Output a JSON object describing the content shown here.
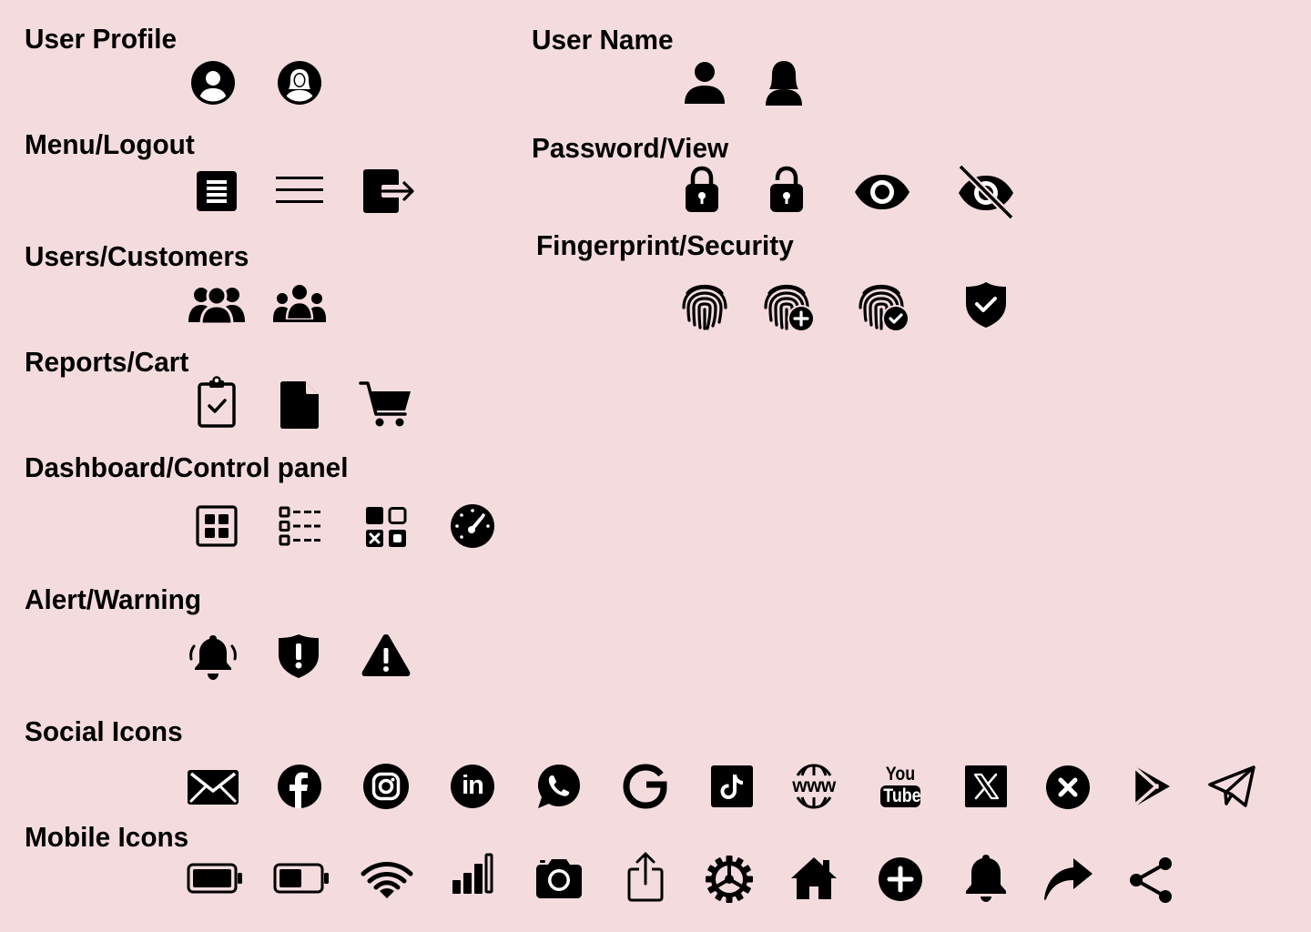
{
  "colors": {
    "background": "#f4dcde",
    "icon": "#000000"
  },
  "groups": {
    "user_profile": {
      "label": "User Profile",
      "icons": [
        "user-circle-icon",
        "user-circle-female-icon"
      ]
    },
    "user_name": {
      "label": "User Name",
      "icons": [
        "user-icon",
        "user-female-icon"
      ]
    },
    "menu_logout": {
      "label": "Menu/Logout",
      "icons": [
        "document-list-icon",
        "hamburger-menu-icon",
        "logout-icon"
      ]
    },
    "password_view": {
      "label": "Password/View",
      "icons": [
        "lock-closed-icon",
        "lock-open-icon",
        "eye-icon",
        "eye-slash-icon"
      ]
    },
    "users_customers": {
      "label": "Users/Customers",
      "icons": [
        "users-icon",
        "customers-group-icon"
      ]
    },
    "fingerprint_security": {
      "label": "Fingerprint/Security",
      "icons": [
        "fingerprint-icon",
        "fingerprint-add-icon",
        "fingerprint-check-icon",
        "shield-check-icon"
      ]
    },
    "reports_cart": {
      "label": "Reports/Cart",
      "icons": [
        "clipboard-check-icon",
        "file-icon",
        "shopping-cart-icon"
      ]
    },
    "dashboard": {
      "label": "Dashboard/Control panel",
      "icons": [
        "dashboard-grid-icon",
        "checklist-icon",
        "control-panel-icon",
        "gauge-icon"
      ]
    },
    "alert_warning": {
      "label": "Alert/Warning",
      "icons": [
        "bell-ringing-icon",
        "shield-alert-icon",
        "warning-triangle-icon"
      ]
    },
    "social": {
      "label": "Social Icons",
      "icons": [
        "email-icon",
        "facebook-icon",
        "instagram-icon",
        "linkedin-icon",
        "whatsapp-icon",
        "google-icon",
        "tiktok-icon",
        "website-icon",
        "youtube-icon",
        "x-twitter-icon",
        "close-circle-icon",
        "google-play-icon",
        "telegram-icon"
      ],
      "linkedin_text": "in",
      "www_text": "www",
      "youtube_top": "You",
      "youtube_bottom": "Tube"
    },
    "mobile": {
      "label": "Mobile Icons",
      "icons": [
        "battery-full-icon",
        "battery-half-icon",
        "wifi-icon",
        "signal-bars-icon",
        "camera-icon",
        "share-upload-icon",
        "settings-gear-icon",
        "home-icon",
        "add-circle-icon",
        "notification-bell-icon",
        "forward-arrow-icon",
        "share-nodes-icon"
      ]
    }
  }
}
